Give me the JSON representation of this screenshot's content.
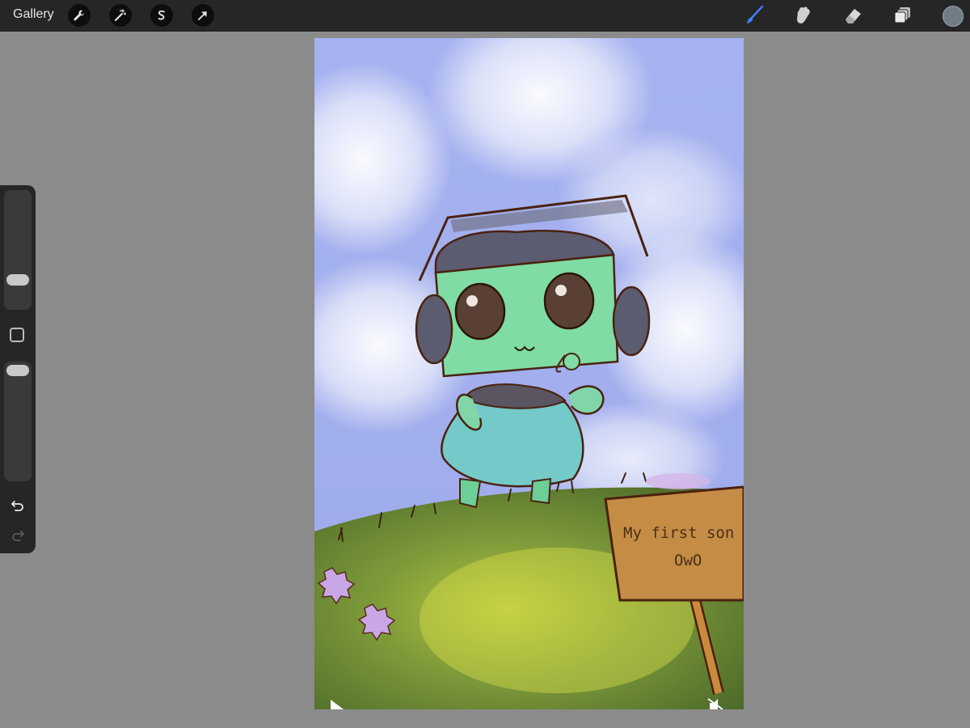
{
  "topbar": {
    "gallery_label": "Gallery",
    "left_tools": [
      "wrench-icon",
      "magic-wand-icon",
      "selection-icon",
      "transform-arrow-icon"
    ],
    "right_tools": [
      "brush-icon",
      "smudge-icon",
      "eraser-icon",
      "layers-icon"
    ],
    "current_color": "#6f7d86",
    "active_tool_color": "#3b82f6"
  },
  "sidebar": {
    "brush_size_level": 0.28,
    "opacity_level": 0.05,
    "controls": [
      "modify-button",
      "undo-icon",
      "redo-icon"
    ]
  },
  "canvas": {
    "sign_line1": "My first son",
    "sign_line2": "OwO",
    "controls": [
      "play-icon",
      "mute-icon"
    ]
  }
}
